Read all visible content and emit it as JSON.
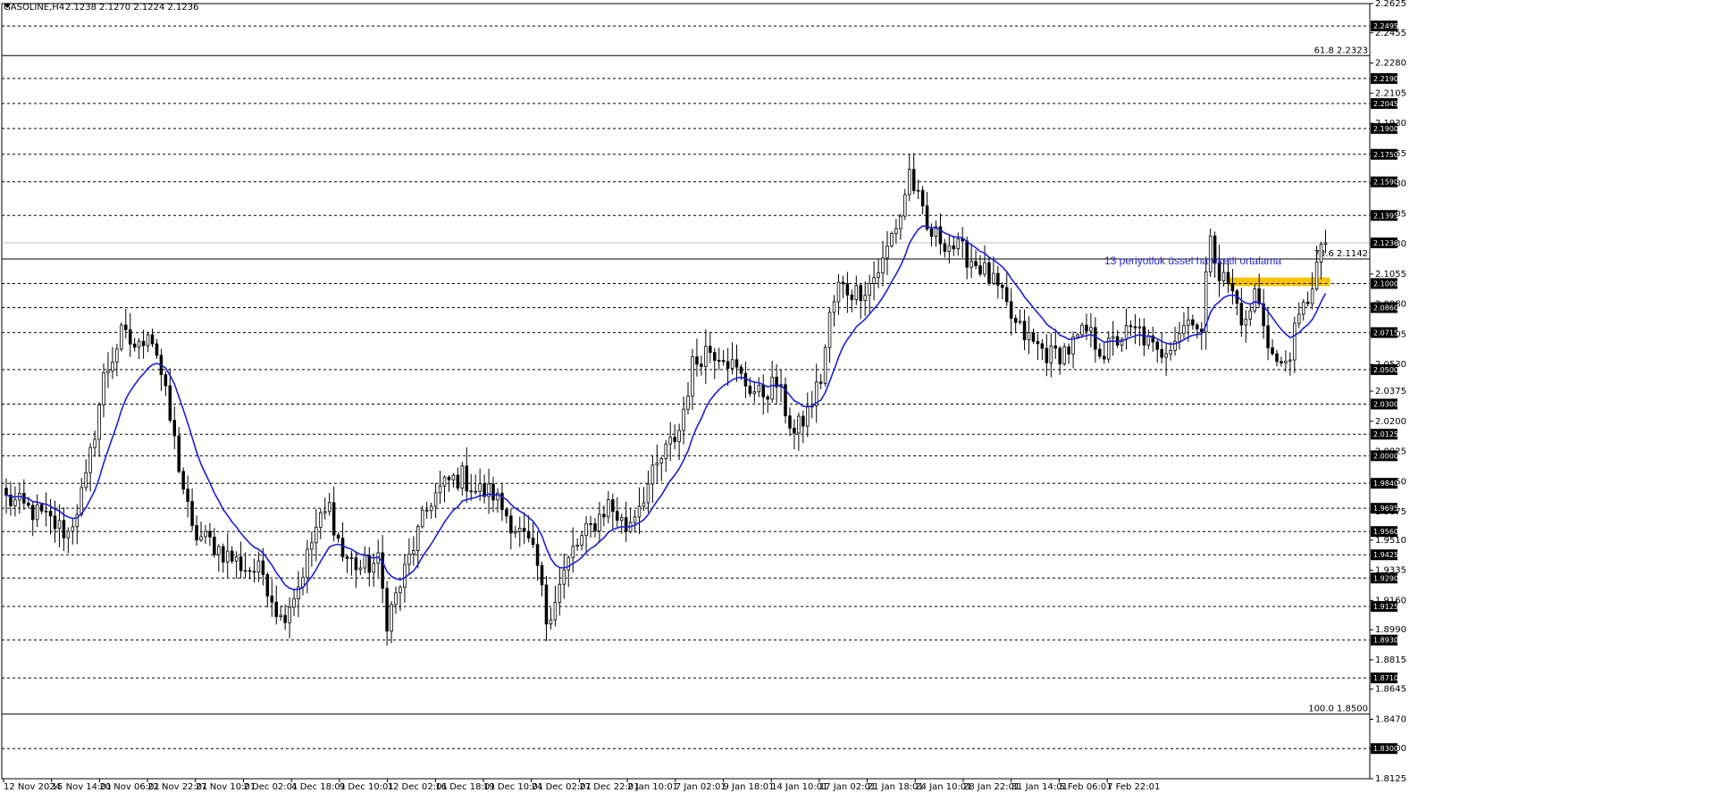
{
  "header": {
    "symbol": "GASOLINE,H4",
    "ohlc": "2.1238 2.1270 2.1224 2.1236"
  },
  "annotation": {
    "ema_label": "13 periyotluk üssel hareketli ortalama"
  },
  "colors": {
    "background": "#ffffff",
    "candle": "#000000",
    "ema": "#1f1fd6",
    "annotation_text": "#2a2ad0",
    "highlight_zone": "#f5c400",
    "dashed_level": "#000000",
    "solid_level": "#000000"
  },
  "chart_data": {
    "type": "candlestick",
    "instrument": "GASOLINE",
    "timeframe": "H4",
    "ylim": [
      1.8125,
      2.2625
    ],
    "price_ticks": [
      "2.2625",
      "2.2455",
      "2.2280",
      "2.2105",
      "2.1930",
      "2.1755",
      "2.1580",
      "2.1405",
      "2.1230",
      "2.1055",
      "2.0880",
      "2.0705",
      "2.0530",
      "2.0375",
      "2.0200",
      "2.0025",
      "1.9850",
      "1.9675",
      "1.9510",
      "1.9335",
      "1.9160",
      "1.8990",
      "1.8815",
      "1.8645",
      "1.8470",
      "1.8300",
      "1.8125"
    ],
    "x_labels": [
      "12 Nov 2024",
      "15 Nov 14:01",
      "20 Nov 06:01",
      "22 Nov 22:01",
      "27 Nov 10:01",
      "2 Dec 02:01",
      "4 Dec 18:01",
      "9 Dec 10:01",
      "12 Dec 02:01",
      "16 Dec 18:01",
      "19 Dec 10:01",
      "24 Dec 02:01",
      "27 Dec 22:01",
      "2 Jan 10:01",
      "7 Jan 02:01",
      "9 Jan 18:01",
      "14 Jan 10:01",
      "17 Jan 02:01",
      "21 Jan 18:01",
      "24 Jan 10:01",
      "28 Jan 22:01",
      "31 Jan 14:01",
      "5 Feb 06:01",
      "7 Feb 22:01"
    ],
    "dashed_levels": [
      2.2495,
      2.219,
      2.2045,
      2.19,
      2.175,
      2.159,
      2.1395,
      2.1,
      2.086,
      2.0715,
      2.05,
      2.03,
      2.0125,
      2.0,
      1.984,
      1.9695,
      1.956,
      1.9425,
      1.929,
      1.9125,
      1.893,
      1.871,
      1.83
    ],
    "fib_levels": [
      {
        "label": "61.8",
        "value": 2.2323
      },
      {
        "label": "73.6",
        "value": 2.1142
      },
      {
        "label": "100.0",
        "value": 1.85
      }
    ],
    "current_price": 2.1236,
    "highlight_zone": {
      "low": 2.0985,
      "high": 2.1035
    },
    "ema_period": 13,
    "waypoints": [
      [
        0,
        1.975
      ],
      [
        8,
        1.965
      ],
      [
        14,
        1.955
      ],
      [
        18,
        1.985
      ],
      [
        22,
        2.045
      ],
      [
        26,
        2.07
      ],
      [
        30,
        2.062
      ],
      [
        32,
        2.075
      ],
      [
        34,
        2.06
      ],
      [
        38,
        2.008
      ],
      [
        42,
        1.955
      ],
      [
        46,
        1.95
      ],
      [
        50,
        1.942
      ],
      [
        54,
        1.935
      ],
      [
        58,
        1.932
      ],
      [
        62,
        1.905
      ],
      [
        66,
        1.925
      ],
      [
        70,
        1.958
      ],
      [
        73,
        1.97
      ],
      [
        76,
        1.942
      ],
      [
        80,
        1.935
      ],
      [
        84,
        1.938
      ],
      [
        86,
        1.905
      ],
      [
        89,
        1.925
      ],
      [
        92,
        1.948
      ],
      [
        96,
        1.975
      ],
      [
        100,
        1.985
      ],
      [
        103,
        1.988
      ],
      [
        106,
        1.98
      ],
      [
        110,
        1.978
      ],
      [
        114,
        1.962
      ],
      [
        118,
        1.948
      ],
      [
        120,
        1.935
      ],
      [
        122,
        1.905
      ],
      [
        125,
        1.925
      ],
      [
        128,
        1.945
      ],
      [
        132,
        1.958
      ],
      [
        136,
        1.972
      ],
      [
        140,
        1.958
      ],
      [
        144,
        1.978
      ],
      [
        148,
        1.998
      ],
      [
        152,
        2.015
      ],
      [
        155,
        2.052
      ],
      [
        158,
        2.062
      ],
      [
        162,
        2.06
      ],
      [
        164,
        2.052
      ],
      [
        166,
        2.045
      ],
      [
        170,
        2.035
      ],
      [
        174,
        2.042
      ],
      [
        178,
        2.012
      ],
      [
        181,
        2.025
      ],
      [
        184,
        2.045
      ],
      [
        186,
        2.08
      ],
      [
        188,
        2.098
      ],
      [
        192,
        2.095
      ],
      [
        195,
        2.1
      ],
      [
        198,
        2.112
      ],
      [
        200,
        2.128
      ],
      [
        202,
        2.14
      ],
      [
        204,
        2.165
      ],
      [
        206,
        2.148
      ],
      [
        208,
        2.13
      ],
      [
        212,
        2.125
      ],
      [
        216,
        2.118
      ],
      [
        220,
        2.11
      ],
      [
        224,
        2.096
      ],
      [
        228,
        2.075
      ],
      [
        232,
        2.065
      ],
      [
        236,
        2.058
      ],
      [
        240,
        2.062
      ],
      [
        244,
        2.072
      ],
      [
        248,
        2.06
      ],
      [
        252,
        2.07
      ],
      [
        256,
        2.072
      ],
      [
        260,
        2.058
      ],
      [
        264,
        2.07
      ],
      [
        268,
        2.082
      ],
      [
        270,
        2.07
      ],
      [
        272,
        2.132
      ],
      [
        274,
        2.105
      ],
      [
        276,
        2.1
      ],
      [
        280,
        2.075
      ],
      [
        282,
        2.095
      ],
      [
        284,
        2.078
      ],
      [
        286,
        2.058
      ],
      [
        288,
        2.05
      ],
      [
        290,
        2.062
      ],
      [
        292,
        2.078
      ],
      [
        294,
        2.092
      ],
      [
        296,
        2.11
      ],
      [
        298,
        2.1236
      ]
    ]
  }
}
